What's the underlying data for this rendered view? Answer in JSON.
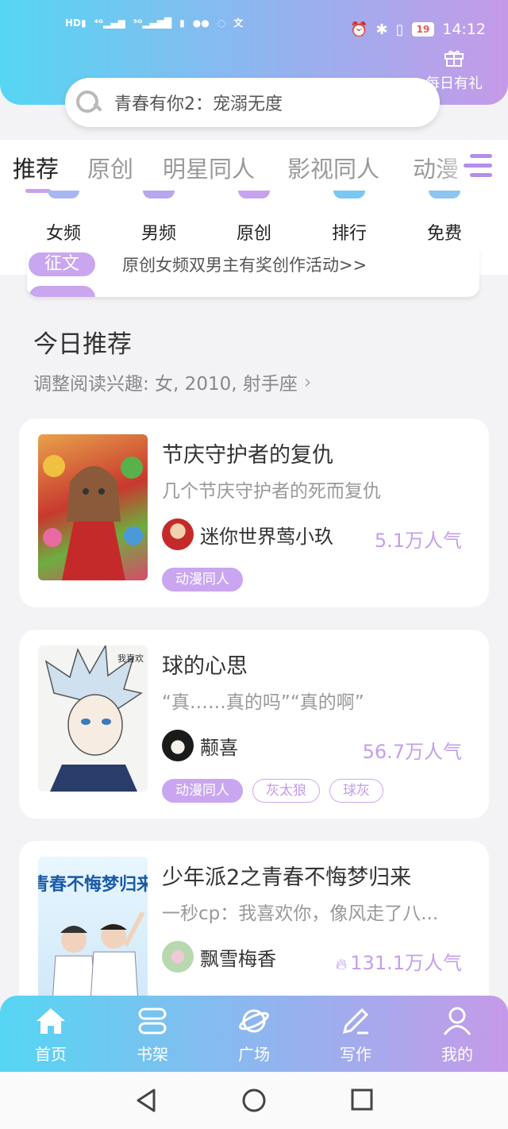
{
  "status_bar": {
    "left_indicators": [
      "HD",
      "4G",
      "5G",
      "wechat",
      "chat",
      "translate"
    ],
    "battery": "19",
    "time": "14:12"
  },
  "header": {
    "gift_label": "每日有礼",
    "search_placeholder": "青春有你2：宠溺无度"
  },
  "tabs": [
    "推荐",
    "原创",
    "明星同人",
    "影视同人",
    "动漫"
  ],
  "categories": [
    "女频",
    "男频",
    "原创",
    "排行",
    "免费"
  ],
  "notice": {
    "badge": "征文",
    "text": "原创女频双男主有奖创作活动>>"
  },
  "section": {
    "title": "今日推荐",
    "interest": "调整阅读兴趣: 女, 2010, 射手座"
  },
  "cards": [
    {
      "title": "节庆守护者的复仇",
      "desc": "几个节庆守护者的死而复仇",
      "author": "迷你世界莺小玖",
      "popularity": "5.1万人气",
      "tags": [
        "动漫同人"
      ]
    },
    {
      "title": "球的心思",
      "desc": "“真……真的吗”“真的啊”",
      "author": "颟喜",
      "popularity": "56.7万人气",
      "tags": [
        "动漫同人",
        "灰太狼",
        "球灰"
      ]
    },
    {
      "title": "少年派2之青春不悔梦归来",
      "desc": "一秒cp：我喜欢你，像风走了八...",
      "author": "飘雪梅香",
      "popularity": "131.1万人气",
      "cover_text": "青春不悔梦归来",
      "tags": []
    }
  ],
  "bottom_nav": [
    "首页",
    "书架",
    "广场",
    "写作",
    "我的"
  ],
  "colors": {
    "accent": "#c9a6ef",
    "gradient_start": "#55d6f2",
    "gradient_end": "#c59ae8"
  }
}
